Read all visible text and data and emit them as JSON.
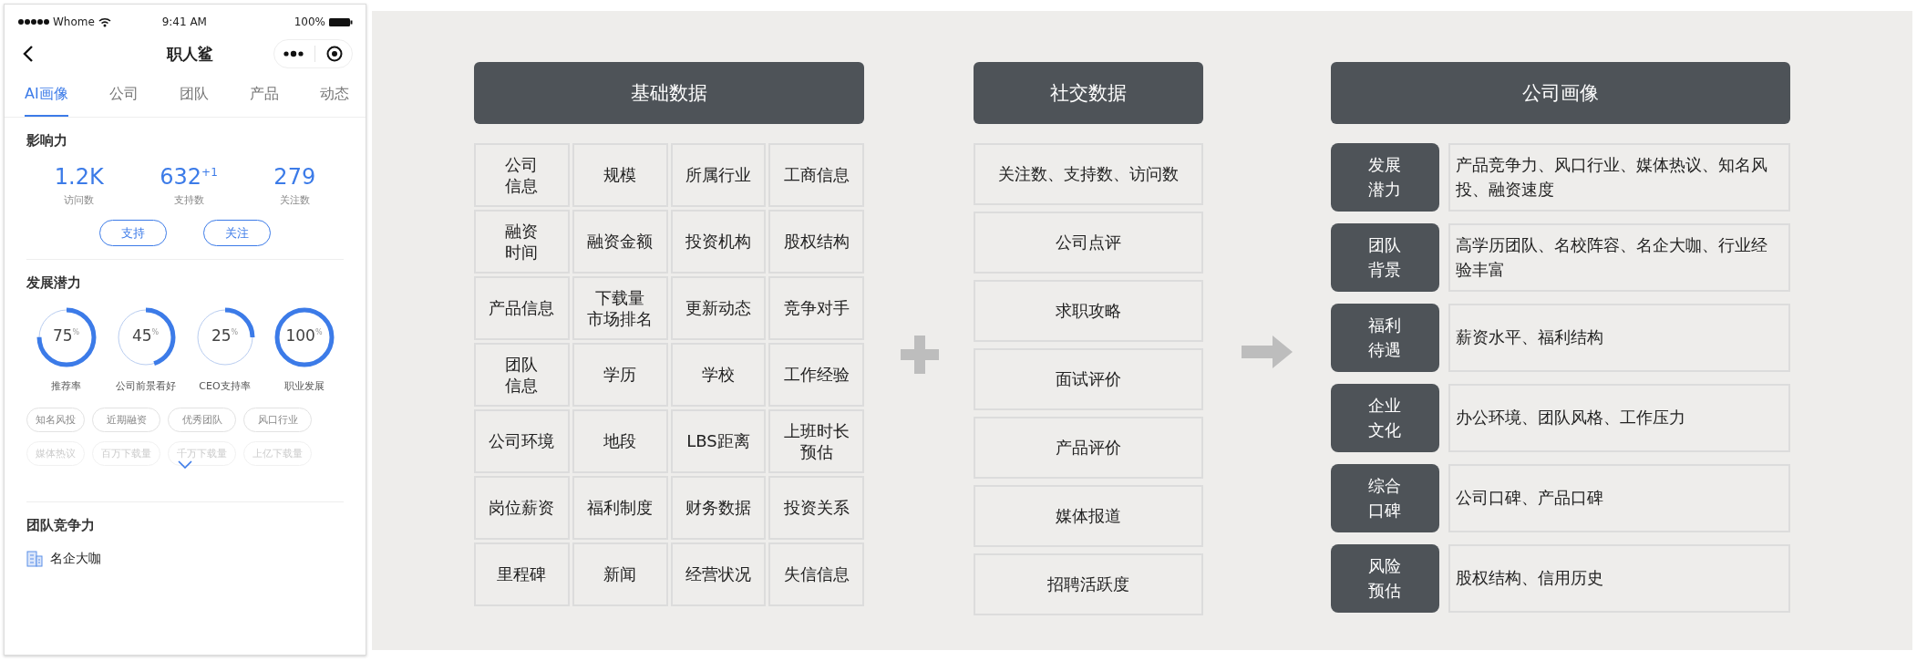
{
  "phone": {
    "status_bar": {
      "carrier": "Whome",
      "time": "9:41 AM",
      "battery": "100%"
    },
    "nav": {
      "title": "职人鲨"
    },
    "tabs": [
      {
        "label": "AI画像",
        "selected": true
      },
      {
        "label": "公司",
        "selected": false
      },
      {
        "label": "团队",
        "selected": false
      },
      {
        "label": "产品",
        "selected": false
      },
      {
        "label": "动态",
        "selected": false
      }
    ],
    "influence": {
      "title": "影响力",
      "stats": [
        {
          "value": "1.2K",
          "label": "访问数"
        },
        {
          "value": "632$^{+1}$",
          "label": "支持数"
        },
        {
          "value": "279",
          "label": "关注数"
        }
      ],
      "buttons": [
        "支持",
        "关注"
      ]
    },
    "potential": {
      "title": "发展潜力",
      "rings": [
        {
          "value": "75$^{%}$",
          "label": "推荐率",
          "level": 0.75
        },
        {
          "value": "45$^{%}$",
          "label": "公司前景看好",
          "level": 0.45
        },
        {
          "value": "25$^{%}$",
          "label": "CEO支持率",
          "level": 0.25
        },
        {
          "value": "100$^{%}$",
          "label": "职业发展",
          "level": 1
        }
      ],
      "tags": [
        {
          "label": "知名风投",
          "faded": false
        },
        {
          "label": "近期融资",
          "faded": false
        },
        {
          "label": "优秀团队",
          "faded": false
        },
        {
          "label": "风口行业",
          "faded": false
        },
        {
          "label": "媒体热议",
          "faded": true
        },
        {
          "label": "百万下载量",
          "faded": true
        },
        {
          "label": "千万下载量",
          "faded": true
        },
        {
          "label": "上亿下载量",
          "faded": true
        }
      ]
    },
    "team": {
      "title": "团队竞争力",
      "items": [
        "名企大咖"
      ]
    }
  },
  "basic_data": {
    "title": "基础数据",
    "rows": [
      [
        [
          "公司",
          "信息"
        ],
        [
          "规模"
        ],
        [
          "所属行业"
        ],
        [
          "工商信息"
        ]
      ],
      [
        [
          "融资",
          "时间"
        ],
        [
          "融资金额"
        ],
        [
          "投资机构"
        ],
        [
          "股权结构"
        ]
      ],
      [
        [
          "产品信息"
        ],
        [
          "下载量",
          "市场排名"
        ],
        [
          "更新动态"
        ],
        [
          "竞争对手"
        ]
      ],
      [
        [
          "团队",
          "信息"
        ],
        [
          "学历"
        ],
        [
          "学校"
        ],
        [
          "工作经验"
        ]
      ],
      [
        [
          "公司环境"
        ],
        [
          "地段"
        ],
        [
          "LBS距离"
        ],
        [
          "上班时长",
          "预估"
        ]
      ],
      [
        [
          "岗位薪资"
        ],
        [
          "福利制度"
        ],
        [
          "财务数据"
        ],
        [
          "投资关系"
        ]
      ],
      [
        [
          "里程碑"
        ],
        [
          "新闻"
        ],
        [
          "经营状况"
        ],
        [
          "失信信息"
        ]
      ]
    ]
  },
  "social_data": {
    "title": "社交数据",
    "items": [
      "关注数、支持数、访问数",
      "公司点评",
      "求职攻略",
      "面试评价",
      "产品评价",
      "媒体报道",
      "招聘活跃度"
    ]
  },
  "portrait": {
    "title": "公司画像",
    "rows": [
      {
        "label": "发展潜力",
        "text": "产品竞争力、风口行业、媒体热议、知名风投、融资速度"
      },
      {
        "label": "团队背景",
        "text": "高学历团队、名校阵容、名企大咖、行业经验丰富"
      },
      {
        "label": "福利待遇",
        "text": "薪资水平、福利结构"
      },
      {
        "label": "企业文化",
        "text": "办公环境、团队风格、工作压力"
      },
      {
        "label": "综合口碑",
        "text": "公司口碑、产品口碑"
      },
      {
        "label": "风险预估",
        "text": "股权结构、信用历史"
      }
    ]
  }
}
